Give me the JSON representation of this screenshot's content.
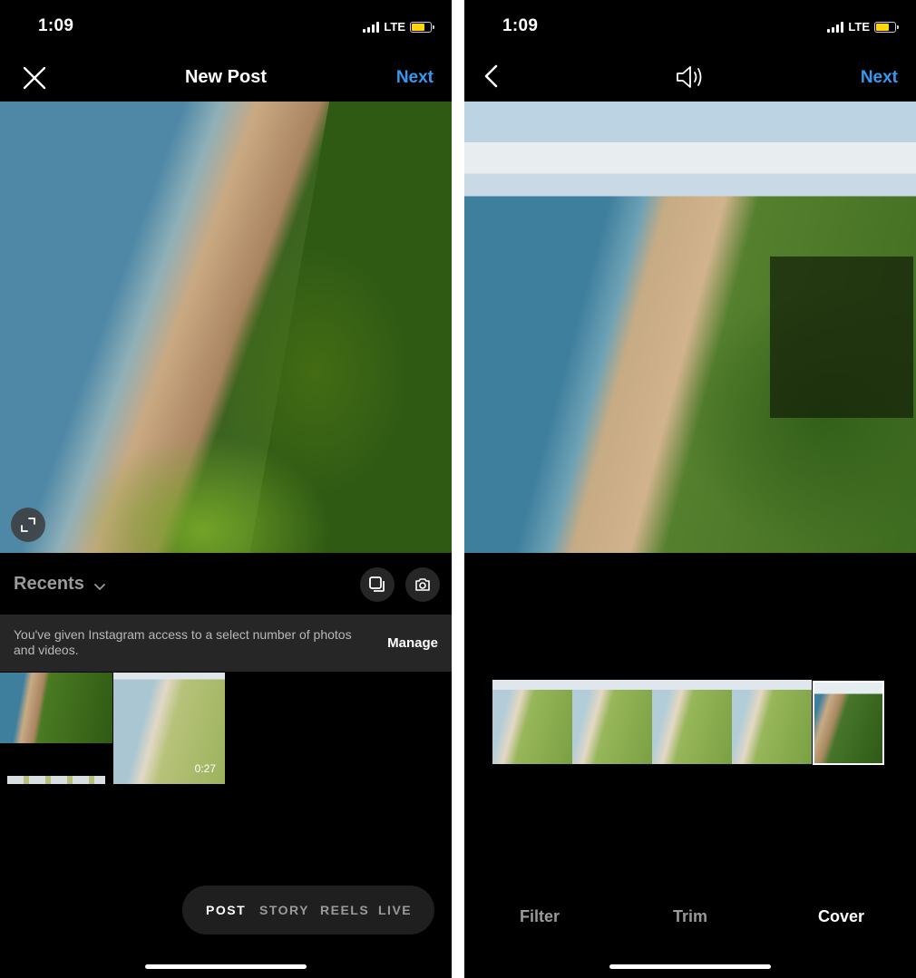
{
  "left": {
    "status": {
      "time": "1:09",
      "network": "LTE"
    },
    "header": {
      "title": "New Post",
      "next_label": "Next"
    },
    "gallery": {
      "album_label": "Recents"
    },
    "access_banner": {
      "message": "You've given Instagram access to a select number of photos and videos.",
      "manage_label": "Manage"
    },
    "thumbnails": [
      {
        "duration": ""
      },
      {
        "duration": "0:27"
      },
      {
        "duration": ""
      }
    ],
    "modes": [
      "POST",
      "STORY",
      "REELS",
      "LIVE"
    ],
    "active_mode": "POST"
  },
  "right": {
    "status": {
      "time": "1:09",
      "network": "LTE"
    },
    "header": {
      "next_label": "Next"
    },
    "tabs": [
      "Filter",
      "Trim",
      "Cover"
    ],
    "active_tab": "Cover"
  },
  "colors": {
    "accent": "#3897f0",
    "background": "#000000",
    "battery": "#ffd60a",
    "banner": "#262626"
  },
  "icons": {
    "left": [
      "close-icon",
      "expand-icon",
      "chevron-down-icon",
      "multi-select-icon",
      "camera-icon"
    ],
    "right": [
      "back-chevron-icon",
      "speaker-icon"
    ]
  }
}
